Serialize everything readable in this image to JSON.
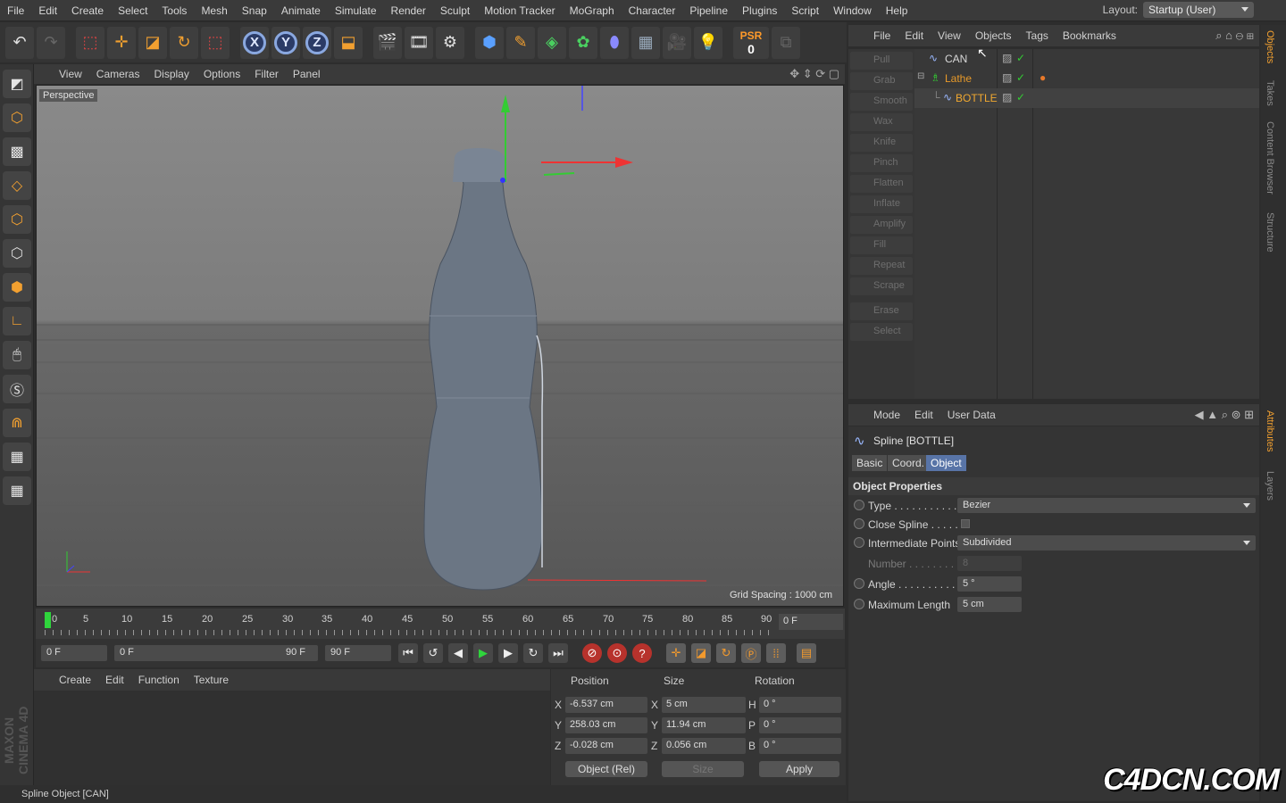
{
  "menubar": {
    "items": [
      "File",
      "Edit",
      "Create",
      "Select",
      "Tools",
      "Mesh",
      "Snap",
      "Animate",
      "Simulate",
      "Render",
      "Sculpt",
      "Motion Tracker",
      "MoGraph",
      "Character",
      "Pipeline",
      "Plugins",
      "Script",
      "Window",
      "Help"
    ],
    "layout_label": "Layout:",
    "layout_value": "Startup (User)"
  },
  "toolbar": {
    "psr_label": "PSR",
    "psr_value": "0",
    "axis_x": "X",
    "axis_y": "Y",
    "axis_z": "Z"
  },
  "viewport": {
    "menu": [
      "View",
      "Cameras",
      "Display",
      "Options",
      "Filter",
      "Panel"
    ],
    "label": "Perspective",
    "grid_spacing": "Grid Spacing : 1000 cm"
  },
  "timeline": {
    "ticks": [
      "0",
      "5",
      "10",
      "15",
      "20",
      "25",
      "30",
      "35",
      "40",
      "45",
      "50",
      "55",
      "60",
      "65",
      "70",
      "75",
      "80",
      "85",
      "90"
    ],
    "current_frame": "0 F"
  },
  "transport": {
    "start_field": "0 F",
    "range_start": "0 F",
    "range_end": "90 F",
    "end_field": "90 F"
  },
  "material_menu": [
    "Create",
    "Edit",
    "Function",
    "Texture"
  ],
  "coords": {
    "headers": {
      "position": "Position",
      "size": "Size",
      "rotation": "Rotation"
    },
    "rows": [
      {
        "axis": "X",
        "pos": "-6.537 cm",
        "saxis": "X",
        "size": "5 cm",
        "raxis": "H",
        "rot": "0 °"
      },
      {
        "axis": "Y",
        "pos": "258.03 cm",
        "saxis": "Y",
        "size": "11.94 cm",
        "raxis": "P",
        "rot": "0 °"
      },
      {
        "axis": "Z",
        "pos": "-0.028 cm",
        "saxis": "Z",
        "size": "0.056 cm",
        "raxis": "B",
        "rot": "0 °"
      }
    ],
    "mode": "Object (Rel)",
    "size_mode": "Size",
    "apply": "Apply"
  },
  "status": "Spline Object [CAN]",
  "sculpt_tools": [
    "Pull",
    "Grab",
    "Smooth",
    "Wax",
    "Knife",
    "Pinch",
    "Flatten",
    "Inflate",
    "Amplify",
    "Fill",
    "Repeat",
    "Scrape",
    "Erase",
    "Select"
  ],
  "objects": {
    "menu": [
      "File",
      "Edit",
      "View",
      "Objects",
      "Tags",
      "Bookmarks"
    ],
    "items": [
      {
        "name": "CAN",
        "color": "#d8d8d8"
      },
      {
        "name": "Lathe",
        "color": "#e89a2a"
      },
      {
        "name": "BOTTLE",
        "color": "#f0a830"
      }
    ]
  },
  "attributes": {
    "menu": [
      "Mode",
      "Edit",
      "User Data"
    ],
    "title": "Spline [BOTTLE]",
    "tabs": [
      "Basic",
      "Coord.",
      "Object"
    ],
    "section": "Object Properties",
    "props": [
      {
        "label": "Type . . . . . . . . . . . .",
        "value": "Bezier"
      },
      {
        "label": "Close Spline . . . . . .",
        "value": ""
      },
      {
        "label": "Intermediate Points",
        "value": "Subdivided"
      },
      {
        "label": "Number . . . . . . . . .",
        "value": "8"
      },
      {
        "label": "Angle . . . . . . . . . . .",
        "value": "5 °"
      },
      {
        "label": "Maximum Length",
        "value": "5 cm"
      }
    ]
  },
  "right_tabs": [
    "Objects",
    "Takes",
    "Content Browser",
    "Structure",
    "Attributes",
    "Layers"
  ],
  "branding": {
    "maxon": "MAXON CINEMA 4D",
    "watermark": "C4DCN.COM"
  }
}
